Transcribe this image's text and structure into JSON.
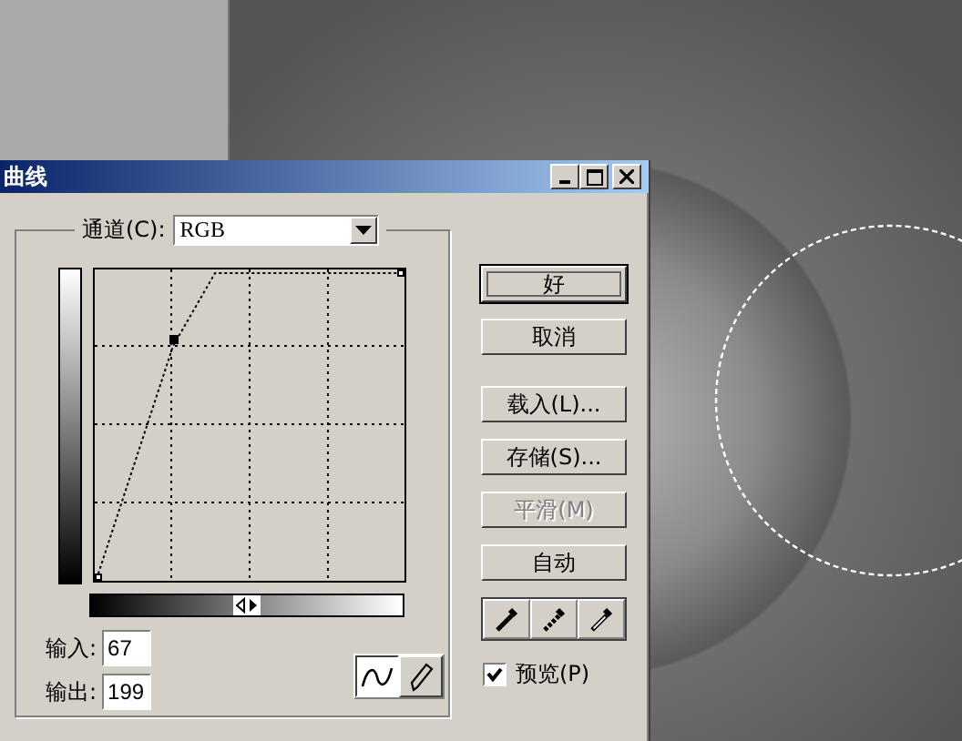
{
  "dialog": {
    "title": "曲线"
  },
  "channel": {
    "label": "通道(C):",
    "value": "RGB"
  },
  "input": {
    "label": "输入:",
    "value": "67"
  },
  "output": {
    "label": "输出:",
    "value": "199"
  },
  "tools": [
    {
      "kind": "curve",
      "selected": true
    },
    {
      "kind": "pencil",
      "selected": false
    }
  ],
  "buttons": [
    {
      "label": "好",
      "default": true,
      "disabled": false
    },
    {
      "label": "取消",
      "default": false,
      "disabled": false
    },
    {
      "label": "载入(L)...",
      "default": false,
      "disabled": false
    },
    {
      "label": "存储(S)...",
      "default": false,
      "disabled": false
    },
    {
      "label": "平滑(M)",
      "default": false,
      "disabled": true
    },
    {
      "label": "自动",
      "default": false,
      "disabled": false
    }
  ],
  "preview": {
    "label": "预览(P)",
    "checked": true
  }
}
